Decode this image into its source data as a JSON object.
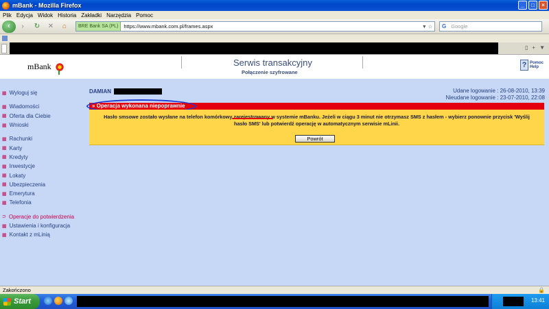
{
  "window": {
    "title": "mBank - Mozilla Firefox",
    "buttons": [
      "_",
      "□",
      "×"
    ]
  },
  "menu": [
    "Plik",
    "Edycja",
    "Widok",
    "Historia",
    "Zakładki",
    "Narzędzia",
    "Pomoc"
  ],
  "nav": {
    "back_icon": "back-arrow-icon",
    "site_identity": "BRE Bank SA (PL)",
    "url": "https://www.mbank.com.pl/frames.aspx",
    "search_placeholder": "Google"
  },
  "bank": {
    "logo": "mBank",
    "service_title": "Serwis transakcyjny",
    "service_subtitle": "Połączenie szyfrowane",
    "help_label_1": "Pomoc",
    "help_label_2": "Help"
  },
  "sidebar": {
    "groups": [
      {
        "items": [
          {
            "label": "Wyloguj się"
          }
        ]
      },
      {
        "items": [
          {
            "label": "Wiadomości"
          },
          {
            "label": "Oferta dla Ciebie"
          },
          {
            "label": "Wnioski"
          }
        ]
      },
      {
        "items": [
          {
            "label": "Rachunki"
          },
          {
            "label": "Karty"
          },
          {
            "label": "Kredyty"
          },
          {
            "label": "Inwestycje"
          },
          {
            "label": "Lokaty"
          },
          {
            "label": "Ubezpieczenia"
          },
          {
            "label": "Emerytura"
          },
          {
            "label": "Telefonia"
          }
        ]
      },
      {
        "items": [
          {
            "label": "Operacje do potwierdzenia",
            "active": true
          },
          {
            "label": "Ustawienia i konfiguracja"
          },
          {
            "label": "Kontakt z mLinią"
          }
        ]
      }
    ]
  },
  "user": {
    "first_name": "DAMIAN",
    "last_login_success": "Udane logowanie : 26-08-2010, 13:39",
    "last_login_failed": "Nieudane logowanie : 23-07-2010, 22:08"
  },
  "message": {
    "error_title": "Operacja wykonana niepoprawnie",
    "body": "Hasło smsowe zostało wysłane na telefon komórkowy zarejestrowany w systemie mBanku. Jeżeli w ciągu 3 minut nie otrzymasz SMS z hasłem - wybierz ponownie przycisk 'Wyślij hasło SMS' lub potwierdź operację w automatycznym serwisie mLinii.",
    "button": "Powrót"
  },
  "status": {
    "text": "Zakończono"
  },
  "taskbar": {
    "start": "Start",
    "clock": "13:41"
  },
  "colors": {
    "error_red": "#e4000f",
    "notice_yellow": "#ffd54a",
    "link_blue": "#263f83",
    "active_red": "#c8004c",
    "bg_blue": "#c6d8f5"
  }
}
